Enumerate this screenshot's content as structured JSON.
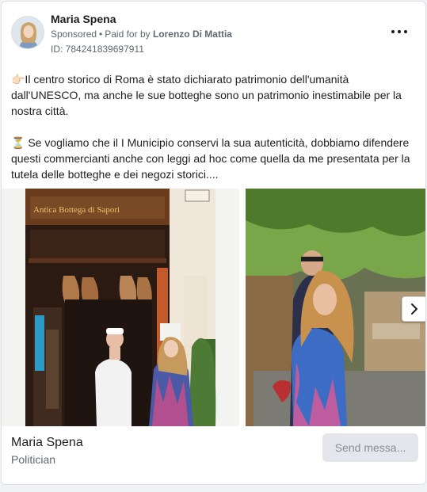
{
  "post": {
    "author": "Maria Spena",
    "sponsored": "Sponsored",
    "dot": "•",
    "paid_for_by_prefix": "Paid for by",
    "payer": "Lorenzo Di Mattia",
    "ad_id": "ID: 784241839697911",
    "paragraphs": [
      "👉🏻Il centro storico di Roma è stato dichiarato patrimonio dell'umanità dall'UNESCO, ma anche le sue botteghe sono un patrimonio inestimabile per la nostra città.",
      "⏳ Se vogliamo che il I Municipio conservi la sua autenticità, dobbiamo difendere questi commercianti anche con leggi ad hoc come quella da me presentata per la tutela delle botteghe e dei negozi storici...."
    ],
    "shop_sign": "Antica Bottega di Sapori"
  },
  "footer": {
    "page_name": "Maria Spena",
    "category": "Politician",
    "send_button": "Send messa..."
  },
  "icons": {
    "more": "more-options-icon",
    "next": "chevron-right-icon"
  }
}
